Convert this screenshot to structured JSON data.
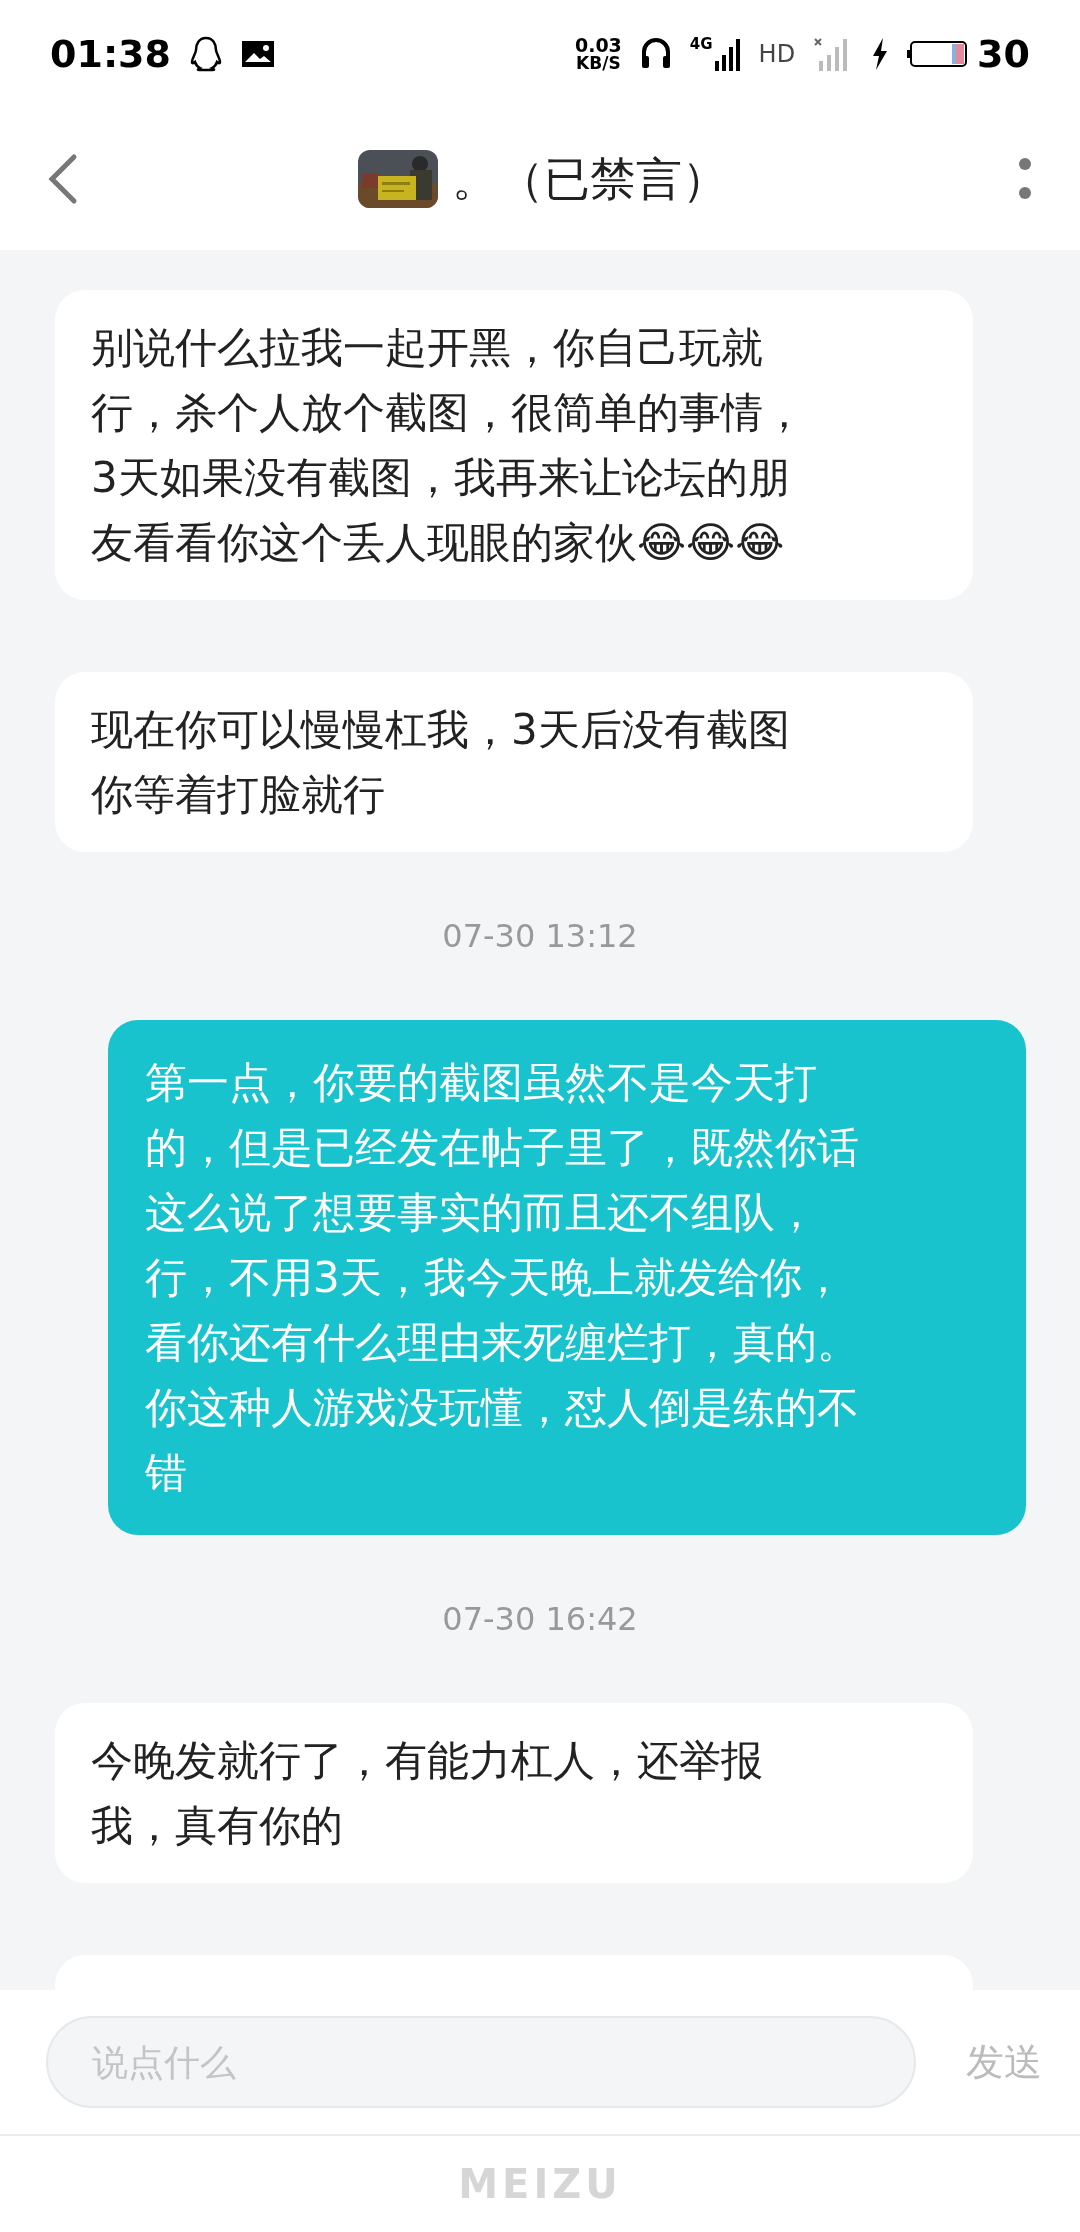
{
  "status_bar": {
    "time": "01:38",
    "speed_value": "0.03",
    "speed_unit": "KB/S",
    "network": "4G",
    "hd": "HD",
    "battery": "30"
  },
  "header": {
    "title": "。（已禁言）"
  },
  "messages": [
    {
      "kind": "incoming",
      "lines": [
        "别说什么拉我一起开黑，你自己玩就",
        "行，杀个人放个截图，很简单的事情，",
        "3天如果没有截图，我再来让论坛的朋",
        "友看看你这个丢人现眼的家伙😂😂😂"
      ]
    },
    {
      "kind": "incoming",
      "lines": [
        "现在你可以慢慢杠我，3天后没有截图",
        "你等着打脸就行"
      ]
    },
    {
      "kind": "time",
      "text": "07-30 13:12"
    },
    {
      "kind": "outgoing",
      "lines": [
        "第一点，你要的截图虽然不是今天打",
        "的，但是已经发在帖子里了，既然你话",
        "这么说了想要事实的而且还不组队，",
        "行，不用3天，我今天晚上就发给你，",
        "看你还有什么理由来死缠烂打，真的。",
        "你这种人游戏没玩懂，怼人倒是练的不",
        "错"
      ]
    },
    {
      "kind": "time",
      "text": "07-30 16:42"
    },
    {
      "kind": "incoming",
      "lines": [
        "今晚发就行了，有能力杠人，还举报",
        "我，真有你的"
      ]
    }
  ],
  "composer": {
    "placeholder": "说点什么",
    "send": "发送"
  },
  "nav_bar": {
    "brand": "MEIZU"
  }
}
